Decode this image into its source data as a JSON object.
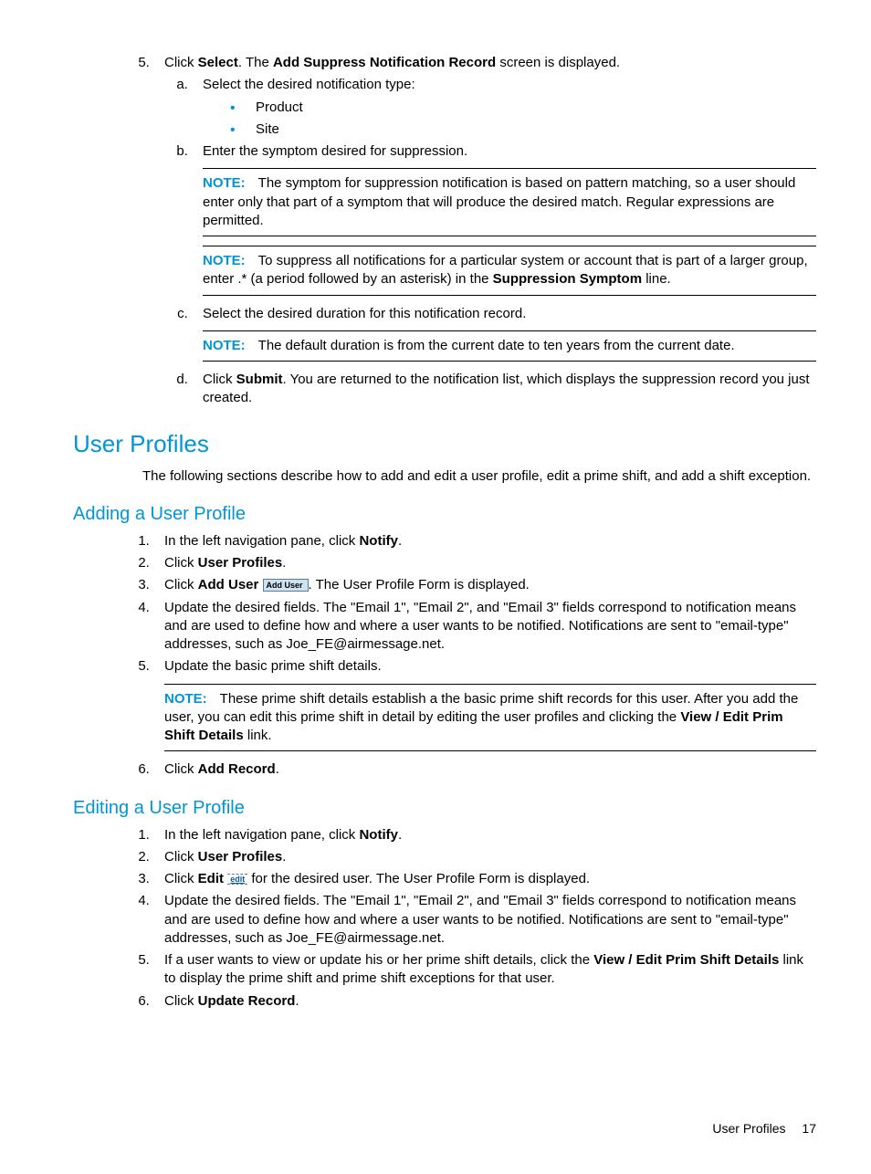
{
  "step5": {
    "num": "5.",
    "pre": "Click ",
    "b1": "Select",
    "mid1": ". The ",
    "b2": "Add Suppress Notification Record",
    "post": " screen is displayed.",
    "a": {
      "marker": "a.",
      "text": "Select the desired notification type:"
    },
    "bullets": [
      "Product",
      "Site"
    ],
    "b": {
      "marker": "b.",
      "text": "Enter the symptom desired for suppression."
    },
    "note1": {
      "label": "NOTE:",
      "text": "The symptom for suppression notification is based on pattern matching, so a user should enter only that part of a symptom that will produce the desired match. Regular expressions are permitted."
    },
    "note2": {
      "label": "NOTE:",
      "pre": "To suppress all notifications for a particular system or account that is part of a larger group, enter .* (a period followed by an asterisk) in the ",
      "bold": "Suppression Symptom",
      "post": " line."
    },
    "c": {
      "marker": "c.",
      "text": "Select the desired duration for this notification record."
    },
    "note3": {
      "label": "NOTE:",
      "text": "The default duration is from the current date to ten years from the current date."
    },
    "d": {
      "marker": "d.",
      "pre": "Click ",
      "bold": "Submit",
      "post": ". You are returned to the notification list, which displays the suppression record you just created."
    }
  },
  "h1": "User Profiles",
  "intro": "The following sections describe how to add and edit a user profile, edit a prime shift, and add a shift exception.",
  "add": {
    "heading": "Adding a User Profile",
    "s1": {
      "pre": "In the left navigation pane, click ",
      "bold": "Notify",
      "post": "."
    },
    "s2": {
      "pre": "Click ",
      "bold": "User Profiles",
      "post": "."
    },
    "s3": {
      "pre": "Click ",
      "bold": "Add User",
      "btn": "Add User",
      "post": ". The User Profile Form is displayed."
    },
    "s4": "Update the desired fields. The \"Email 1\", \"Email 2\", and \"Email 3\" fields correspond to notification means and are used to define how and where a user wants to be notified. Notifications are sent to \"email-type\" addresses, such as Joe_FE@airmessage.net.",
    "s5": "Update the basic prime shift details.",
    "note": {
      "label": "NOTE:",
      "pre": "These prime shift details establish a the basic prime shift records for this user. After you add the user, you can edit this prime shift in detail by editing the user profiles and clicking the ",
      "bold": "View / Edit Prim Shift Details",
      "post": " link."
    },
    "s6": {
      "pre": "Click ",
      "bold": "Add Record",
      "post": "."
    }
  },
  "edit": {
    "heading": "Editing a User Profile",
    "s1": {
      "pre": "In the left navigation pane, click ",
      "bold": "Notify",
      "post": "."
    },
    "s2": {
      "pre": "Click ",
      "bold": "User Profiles",
      "post": "."
    },
    "s3": {
      "pre": "Click ",
      "bold": "Edit",
      "btn": "edit",
      "post": " for the desired user. The User Profile Form is displayed."
    },
    "s4": "Update the desired fields. The \"Email 1\", \"Email 2\", and \"Email 3\" fields correspond to notification means and are used to define how and where a user wants to be notified. Notifications are sent to \"email-type\" addresses, such as Joe_FE@airmessage.net.",
    "s5": {
      "pre": "If a user wants to view or update his or her prime shift details, click the ",
      "bold": "View / Edit Prim Shift Details",
      "post": " link to display the prime shift and prime shift exceptions for that user."
    },
    "s6": {
      "pre": "Click ",
      "bold": "Update Record",
      "post": "."
    }
  },
  "footer": {
    "section": "User Profiles",
    "page": "17"
  }
}
